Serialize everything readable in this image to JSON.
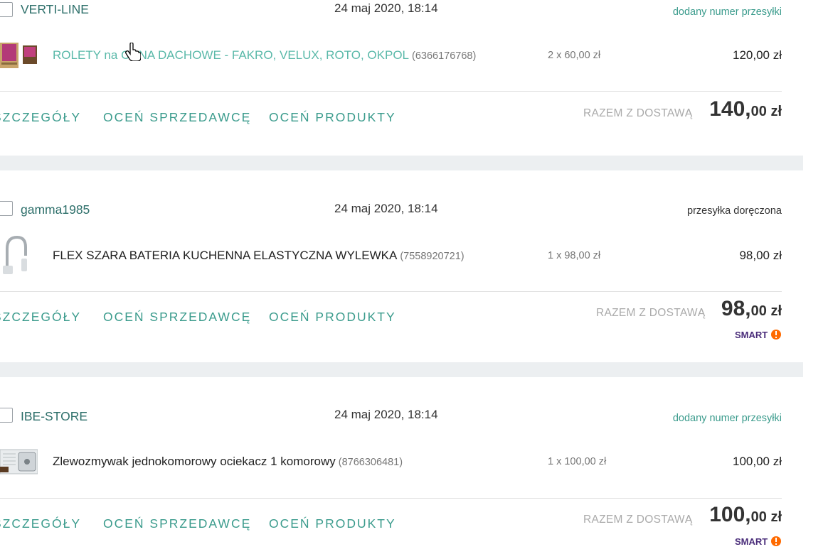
{
  "orders": [
    {
      "seller": "VERTI-LINE",
      "date": "24 maj 2020, 18:14",
      "status": "dodany numer przesyłki",
      "product_name": "ROLETY na OKNA DACHOWE - FAKRO, VELUX, ROTO, OKPOL",
      "product_id": "(6366176768)",
      "quantity": "2 x 60,00 zł",
      "price": "120,00 zł",
      "actions": [
        "SZCZEGÓŁY",
        "OCEŃ SPRZEDAWCĘ",
        "OCEŃ PRODUKTY"
      ],
      "total_label": "RAZEM Z DOSTAWĄ",
      "total_main": "140,",
      "total_sub": "00 zł"
    },
    {
      "seller": "gamma1985",
      "date": "24 maj 2020, 18:14",
      "status": "przesyłka doręczona",
      "product_name": "FLEX SZARA BATERIA KUCHENNA ELASTYCZNA WYLEWKA",
      "product_id": "(7558920721)",
      "quantity": "1 x 98,00 zł",
      "price": "98,00 zł",
      "actions": [
        "SZCZEGÓŁY",
        "OCEŃ SPRZEDAWCĘ",
        "OCEŃ PRODUKTY"
      ],
      "total_label": "RAZEM Z DOSTAWĄ",
      "total_main": "98,",
      "total_sub": "00 zł",
      "badge": "SMART!"
    },
    {
      "seller": "IBE-STORE",
      "date": "24 maj 2020, 18:14",
      "status": "dodany numer przesyłki",
      "product_name": "Zlewozmywak jednokomorowy ociekacz 1 komorowy",
      "product_id": "(8766306481)",
      "quantity": "1 x 100,00 zł",
      "price": "100,00 zł",
      "actions": [
        "SZCZEGÓŁY",
        "OCEŃ SPRZEDAWCĘ",
        "OCEŃ PRODUKTY"
      ],
      "total_label": "RAZEM Z DOSTAWĄ",
      "total_main": "100,",
      "total_sub": "00 zł",
      "badge": "SMART!"
    }
  ],
  "colors": {
    "accent": "#3a9b8c",
    "link": "#5ab9a9",
    "smart_purple": "#4a2d7a",
    "smart_orange": "#ff6a00"
  }
}
